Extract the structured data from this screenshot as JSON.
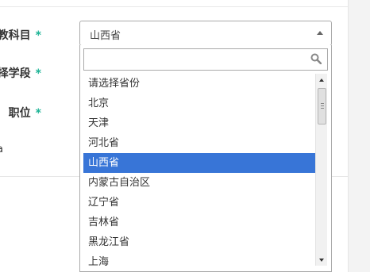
{
  "form": {
    "subject_label": "所教科目",
    "stage_label": "选择学段",
    "position_label": "职位",
    "required_mark": "*",
    "cut_label": "a"
  },
  "select": {
    "value": "山西省",
    "search_value": "",
    "options": [
      "请选择省份",
      "北京",
      "天津",
      "河北省",
      "山西省",
      "内蒙古自治区",
      "辽宁省",
      "吉林省",
      "黑龙江省",
      "上海"
    ],
    "selected_option": "山西省"
  },
  "colors": {
    "required": "#1ab394",
    "selected_bg": "#3875d7",
    "selected_text": "#ffffff"
  },
  "icons": {
    "search": "search-icon",
    "dropdown_arrow": "caret-up-icon",
    "scroll_up": "scroll-up-arrow-icon",
    "scroll_down": "scroll-down-arrow-icon"
  }
}
